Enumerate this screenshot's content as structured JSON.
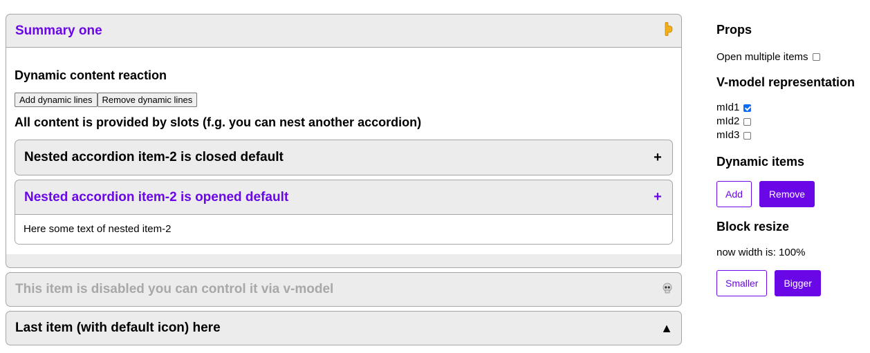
{
  "accordion": {
    "item1": {
      "title": "Summary one",
      "icon": "pointing-hand-icon",
      "body": {
        "heading1": "Dynamic content reaction",
        "add_btn": "Add dynamic lines",
        "remove_btn": "Remove dynamic lines",
        "heading2": "All content is provided by slots (f.g. you can nest another accordion)",
        "nested": [
          {
            "title": "Nested accordion item-2 is closed default",
            "icon": "+"
          },
          {
            "title": "Nested accordion item-2 is opened default",
            "icon": "+",
            "body": "Here some text of nested item-2"
          }
        ]
      }
    },
    "item2": {
      "title": "This item is disabled you can control it via v-model",
      "icon": "skull-icon"
    },
    "item3": {
      "title": "Last item (with default icon) here",
      "icon": "▲"
    }
  },
  "side": {
    "props_title": "Props",
    "open_multiple_label": "Open multiple items",
    "vmodel_title": "V-model representation",
    "vmodel": [
      {
        "label": "mId1",
        "checked": true
      },
      {
        "label": "mId2",
        "checked": false
      },
      {
        "label": "mId3",
        "checked": false
      }
    ],
    "dynamic_title": "Dynamic items",
    "add_label": "Add",
    "remove_label": "Remove",
    "resize_title": "Block resize",
    "width_text": "now width is: 100%",
    "smaller_label": "Smaller",
    "bigger_label": "Bigger"
  },
  "colors": {
    "accent": "#6a07e6",
    "disabled_text": "#a8a8a8",
    "header_bg": "#ececec"
  }
}
